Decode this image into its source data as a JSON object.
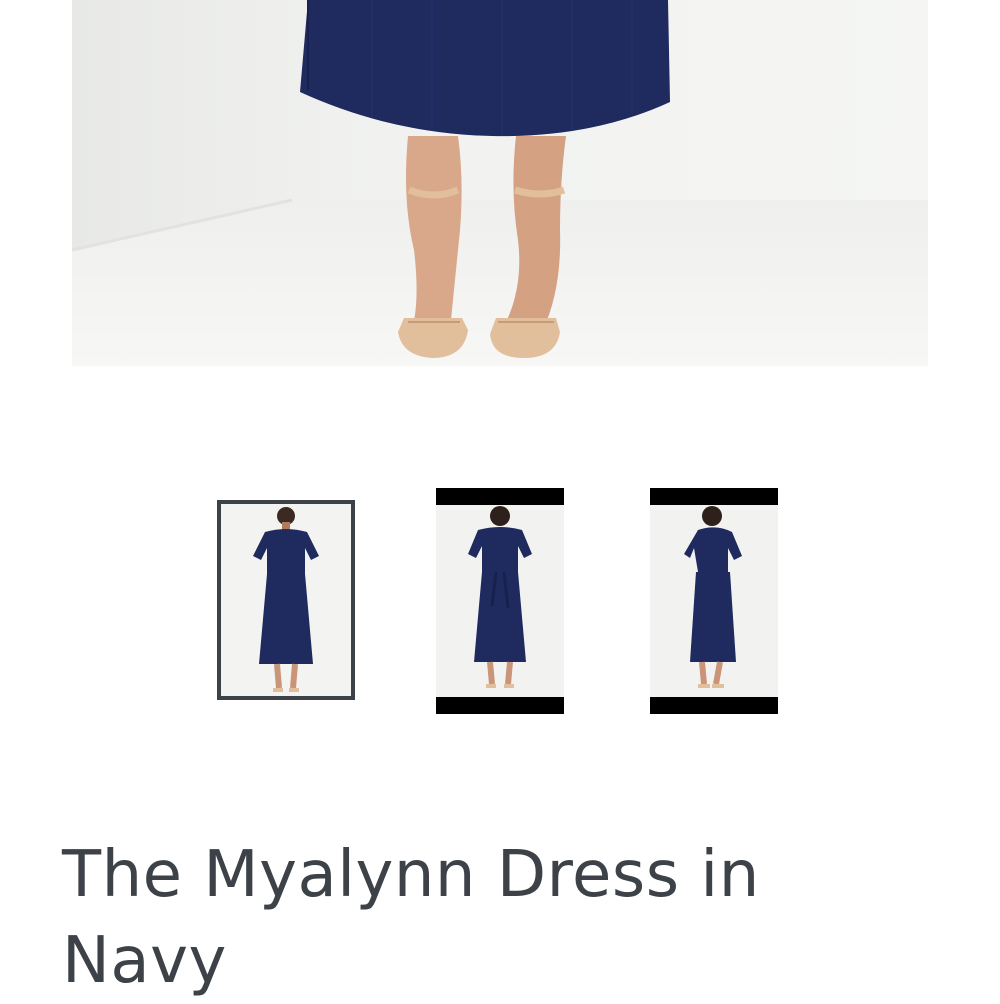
{
  "product": {
    "title": "The Myalynn Dress in Navy"
  },
  "gallery": {
    "selected_index": 0,
    "thumbnails": [
      {
        "view": "front",
        "selected": true
      },
      {
        "view": "back",
        "selected": false
      },
      {
        "view": "side",
        "selected": false
      }
    ]
  },
  "colors": {
    "dress": "#1f2a5e",
    "text": "#3c4247",
    "selected_border": "#3c4247",
    "skin": "#d9a88a",
    "sandal": "#e2bf9c",
    "backdrop": "#eeefed"
  }
}
